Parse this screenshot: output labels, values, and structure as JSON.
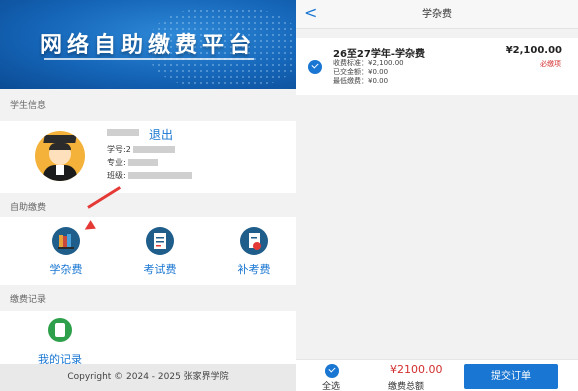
{
  "left": {
    "banner_title": "网络自助缴费平台",
    "section_student": "学生信息",
    "logout": "退出",
    "student_id_label": "学号:",
    "student_id_partial": "2",
    "major_label": "专业:",
    "class_label": "班级:",
    "section_self_pay": "自助缴费",
    "tiles": [
      {
        "label": "学杂费",
        "icon": "books-icon"
      },
      {
        "label": "考试费",
        "icon": "exam-paper-icon"
      },
      {
        "label": "补考费",
        "icon": "retake-exam-icon"
      }
    ],
    "section_records": "缴费记录",
    "my_records": "我的记录",
    "footer": "Copyright © 2024 - 2025 张家界学院"
  },
  "right": {
    "back": "<",
    "title": "学杂费",
    "item": {
      "name": "26至27学年-学杂费",
      "price": "¥2,100.00",
      "required": "必缴项",
      "standard": "收费标准：¥2,100.00",
      "paid": "已交金额：¥0.00",
      "min_pay": "最低缴费：¥0.00"
    },
    "bottom": {
      "select_all": "全选",
      "total_value": "¥2100.00",
      "total_label": "缴费总额",
      "submit": "提交订单"
    }
  },
  "colors": {
    "accent": "#1976d2",
    "danger": "#d32f2f",
    "banner": "#1565b8"
  }
}
